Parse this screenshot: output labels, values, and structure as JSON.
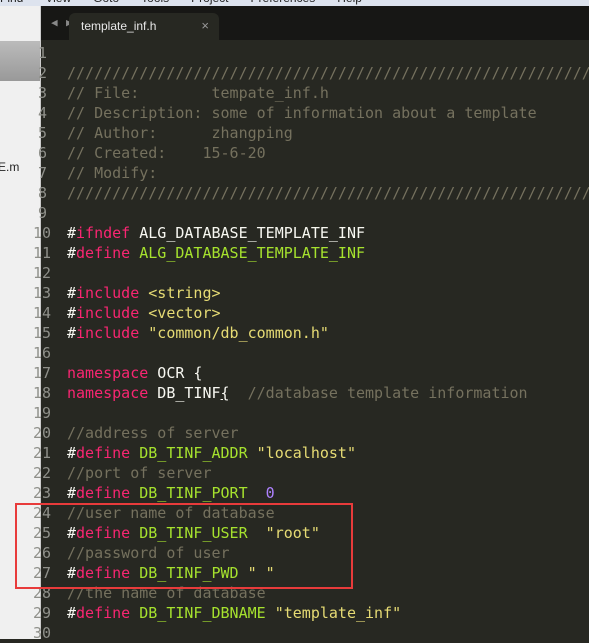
{
  "menu": [
    "Find",
    "View",
    "Goto",
    "Tools",
    "Project",
    "Preferences",
    "Help"
  ],
  "sidebar": {
    "file_fragment": "E.m"
  },
  "tab": {
    "title": "template_inf.h",
    "close": "×",
    "back": "◀",
    "forward": "▶"
  },
  "lines": [
    [],
    [
      [
        "c",
        "////////////////////////////////////////////////////////////"
      ]
    ],
    [
      [
        "c",
        "// File:        tempate_inf.h"
      ]
    ],
    [
      [
        "c",
        "// Description: some of information about a template"
      ]
    ],
    [
      [
        "c",
        "// Author:      zhangping"
      ]
    ],
    [
      [
        "c",
        "// Created:    15-6-20"
      ]
    ],
    [
      [
        "c",
        "// Modify:"
      ]
    ],
    [
      [
        "c",
        "////////////////////////////////////////////////////////////"
      ]
    ],
    [],
    [
      [
        "p",
        "#"
      ],
      [
        "k",
        "ifndef"
      ],
      [
        "p",
        " ALG_DATABASE_TEMPLATE_INF"
      ]
    ],
    [
      [
        "p",
        "#"
      ],
      [
        "k",
        "define"
      ],
      [
        "d",
        " ALG_DATABASE_TEMPLATE_INF"
      ]
    ],
    [],
    [
      [
        "p",
        "#"
      ],
      [
        "k",
        "include"
      ],
      [
        "s",
        " <string>"
      ]
    ],
    [
      [
        "p",
        "#"
      ],
      [
        "k",
        "include"
      ],
      [
        "s",
        " <vector>"
      ]
    ],
    [
      [
        "p",
        "#"
      ],
      [
        "k",
        "include"
      ],
      [
        "s",
        " \"common/db_common.h\""
      ]
    ],
    [],
    [
      [
        "k",
        "namespace"
      ],
      [
        "p",
        " OCR {"
      ]
    ],
    [
      [
        "k",
        "namespace"
      ],
      [
        "p",
        " DB_TINF"
      ],
      [
        "u",
        "{"
      ],
      [
        "c",
        "  //database template information"
      ]
    ],
    [],
    [
      [
        "c",
        "//address of server"
      ]
    ],
    [
      [
        "p",
        "#"
      ],
      [
        "k",
        "define"
      ],
      [
        "d",
        " DB_TINF_ADDR"
      ],
      [
        "s",
        " \"localhost\""
      ]
    ],
    [
      [
        "c",
        "//port of server"
      ]
    ],
    [
      [
        "p",
        "#"
      ],
      [
        "k",
        "define"
      ],
      [
        "d",
        " DB_TINF_PORT"
      ],
      [
        "n",
        "  0"
      ]
    ],
    [
      [
        "c",
        "//user name of database"
      ]
    ],
    [
      [
        "p",
        "#"
      ],
      [
        "k",
        "define"
      ],
      [
        "d",
        " DB_TINF_USER"
      ],
      [
        "s",
        "  \"root\""
      ]
    ],
    [
      [
        "c",
        "//password of user"
      ]
    ],
    [
      [
        "p",
        "#"
      ],
      [
        "k",
        "define"
      ],
      [
        "d",
        " DB_TINF_PWD"
      ],
      [
        "s",
        " \" \""
      ]
    ],
    [
      [
        "c",
        "//the name of database"
      ]
    ],
    [
      [
        "p",
        "#"
      ],
      [
        "k",
        "define"
      ],
      [
        "d",
        " DB_TINF_DBNAME"
      ],
      [
        "s",
        " \"template_inf\""
      ]
    ],
    []
  ],
  "colors": {
    "background": "#272822",
    "comment": "#75715e",
    "keyword": "#f92672",
    "macro": "#a6e22e",
    "string": "#e6db74",
    "number": "#ae81ff",
    "highlight_box": "#e83b3b"
  },
  "highlight": {
    "lines": [
      24,
      27
    ]
  }
}
